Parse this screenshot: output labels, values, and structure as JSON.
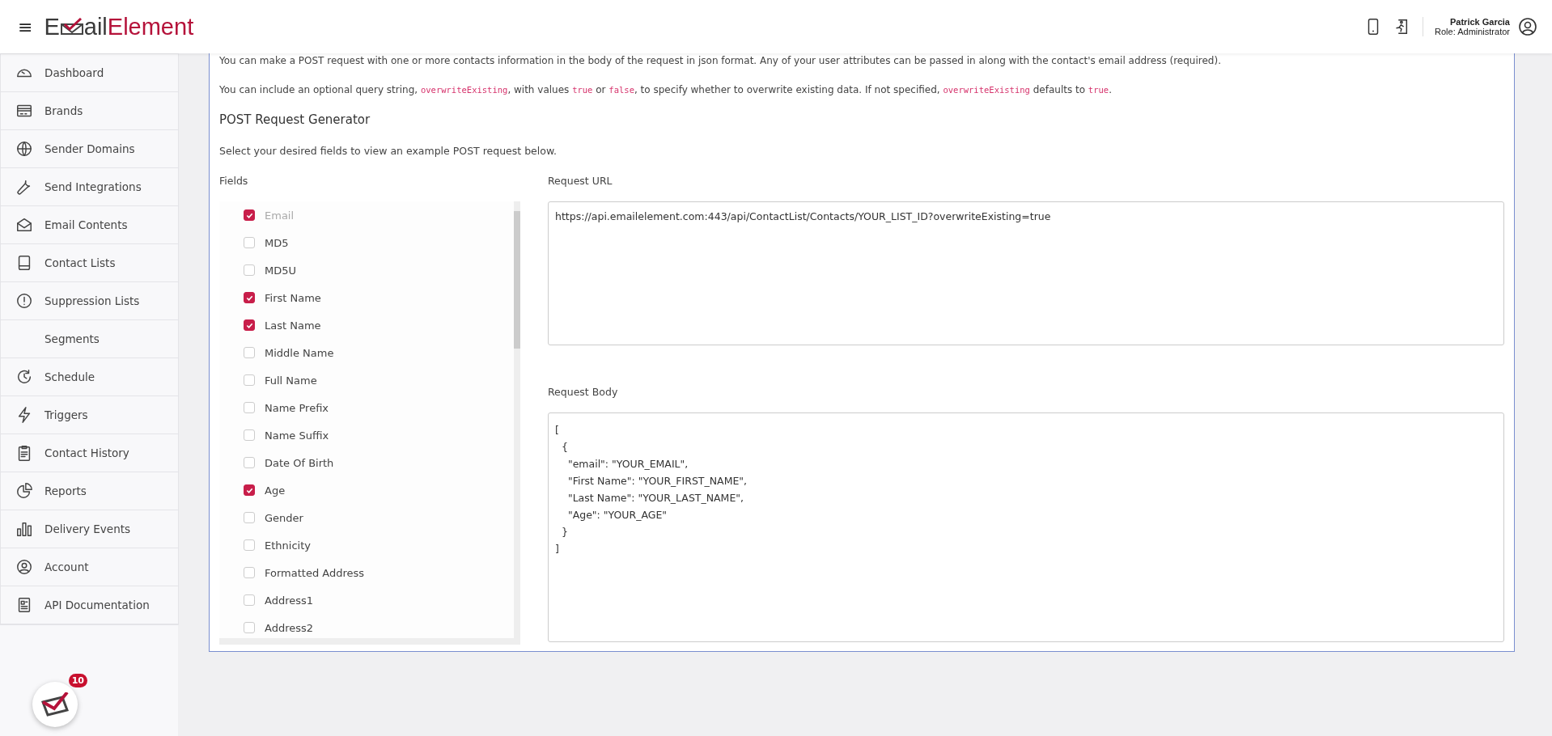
{
  "header": {
    "menu_glyph": "≡",
    "logo": {
      "first": "E",
      "middle": "ail",
      "last": "Element"
    },
    "user": {
      "name": "Patrick Garcia",
      "role": "Role: Administrator"
    }
  },
  "sidebar": {
    "items": [
      {
        "label": "Dashboard"
      },
      {
        "label": "Brands"
      },
      {
        "label": "Sender Domains"
      },
      {
        "label": "Send Integrations"
      },
      {
        "label": "Email Contents"
      },
      {
        "label": "Contact Lists"
      },
      {
        "label": "Suppression Lists"
      },
      {
        "label": "Segments"
      },
      {
        "label": "Schedule"
      },
      {
        "label": "Triggers"
      },
      {
        "label": "Contact History"
      },
      {
        "label": "Reports"
      },
      {
        "label": "Delivery Events"
      },
      {
        "label": "Account"
      },
      {
        "label": "API Documentation"
      }
    ]
  },
  "notification_badge": "10",
  "content": {
    "paragraphs": [
      [
        {
          "kind": "text",
          "text": "You can make a POST request with one or more contacts information in the body of the request in json format. Any of your user attributes can be passed in along with the contact's email address (required)."
        }
      ],
      [
        {
          "kind": "text",
          "text": "You can include an optional query string, "
        },
        {
          "kind": "code",
          "text": "overwriteExisting"
        },
        {
          "kind": "text",
          "text": ", with values "
        },
        {
          "kind": "code",
          "text": "true"
        },
        {
          "kind": "text",
          "text": " or "
        },
        {
          "kind": "code",
          "text": "false"
        },
        {
          "kind": "text",
          "text": ", to specify whether to overwrite existing data. If not specified, "
        },
        {
          "kind": "code",
          "text": "overwriteExisting"
        },
        {
          "kind": "text",
          "text": " defaults to "
        },
        {
          "kind": "code",
          "text": "true"
        },
        {
          "kind": "text",
          "text": "."
        }
      ]
    ],
    "heading": "POST Request Generator",
    "intro": "Select your desired fields to view an example POST request below.",
    "fields_label": "Fields",
    "fields": [
      {
        "label": "Email",
        "checked": true,
        "disabled": true
      },
      {
        "label": "MD5",
        "checked": false,
        "disabled": false
      },
      {
        "label": "MD5U",
        "checked": false,
        "disabled": false
      },
      {
        "label": "First Name",
        "checked": true,
        "disabled": false
      },
      {
        "label": "Last Name",
        "checked": true,
        "disabled": false
      },
      {
        "label": "Middle Name",
        "checked": false,
        "disabled": false
      },
      {
        "label": "Full Name",
        "checked": false,
        "disabled": false
      },
      {
        "label": "Name Prefix",
        "checked": false,
        "disabled": false
      },
      {
        "label": "Name Suffix",
        "checked": false,
        "disabled": false
      },
      {
        "label": "Date Of Birth",
        "checked": false,
        "disabled": false
      },
      {
        "label": "Age",
        "checked": true,
        "disabled": false
      },
      {
        "label": "Gender",
        "checked": false,
        "disabled": false
      },
      {
        "label": "Ethnicity",
        "checked": false,
        "disabled": false
      },
      {
        "label": "Formatted Address",
        "checked": false,
        "disabled": false
      },
      {
        "label": "Address1",
        "checked": false,
        "disabled": false
      },
      {
        "label": "Address2",
        "checked": false,
        "disabled": false
      }
    ],
    "request_url_label": "Request URL",
    "request_url": "https://api.emailelement.com:443/api/ContactList/Contacts/YOUR_LIST_ID?overwriteExisting=true",
    "request_body_label": "Request Body",
    "request_body": [
      "[",
      "  {",
      "    \"email\": \"YOUR_EMAIL\",",
      "    \"First Name\": \"YOUR_FIRST_NAME\",",
      "    \"Last Name\": \"YOUR_LAST_NAME\",",
      "    \"Age\": \"YOUR_AGE\"",
      "  }",
      "]"
    ]
  }
}
